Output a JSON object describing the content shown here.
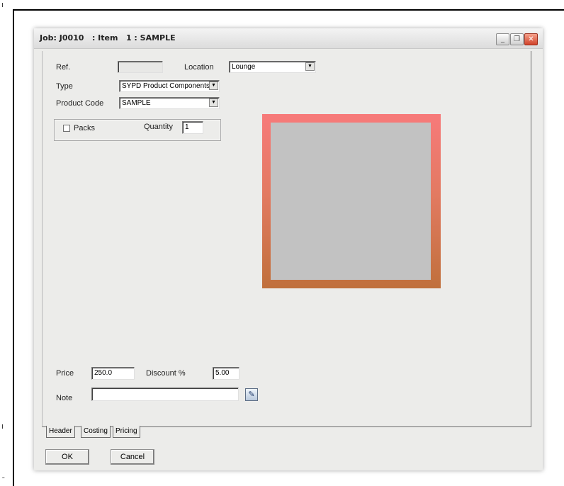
{
  "window": {
    "title": "Job: J0010   : Item   1 : SAMPLE",
    "minimize_glyph": "_",
    "restore_glyph": "❐",
    "close_glyph": "✕"
  },
  "form": {
    "ref_label": "Ref.",
    "ref_value": "",
    "location_label": "Location",
    "location_value": "Lounge",
    "type_label": "Type",
    "type_value": "SYPD  Product Components",
    "product_code_label": "Product Code",
    "product_code_value": "SAMPLE",
    "packs_label": "Packs",
    "packs_checked": false,
    "quantity_label": "Quantity",
    "quantity_value": "1",
    "price_label": "Price",
    "price_value": "250.0",
    "discount_label": "Discount %",
    "discount_value": "5.00",
    "note_label": "Note",
    "note_value": ""
  },
  "swatch": {
    "border_top_color": "#f77a7a",
    "border_bottom_color": "#c0703c",
    "fill_color": "#c2c2c2"
  },
  "tabs": [
    {
      "label": "Header",
      "active": true
    },
    {
      "label": "Costing",
      "active": false
    },
    {
      "label": "Pricing",
      "active": false
    }
  ],
  "buttons": {
    "ok_label": "OK",
    "cancel_label": "Cancel"
  },
  "corner_glyphs": {
    "top": "ı",
    "mid": "ı",
    "bottom": "ˉ"
  }
}
